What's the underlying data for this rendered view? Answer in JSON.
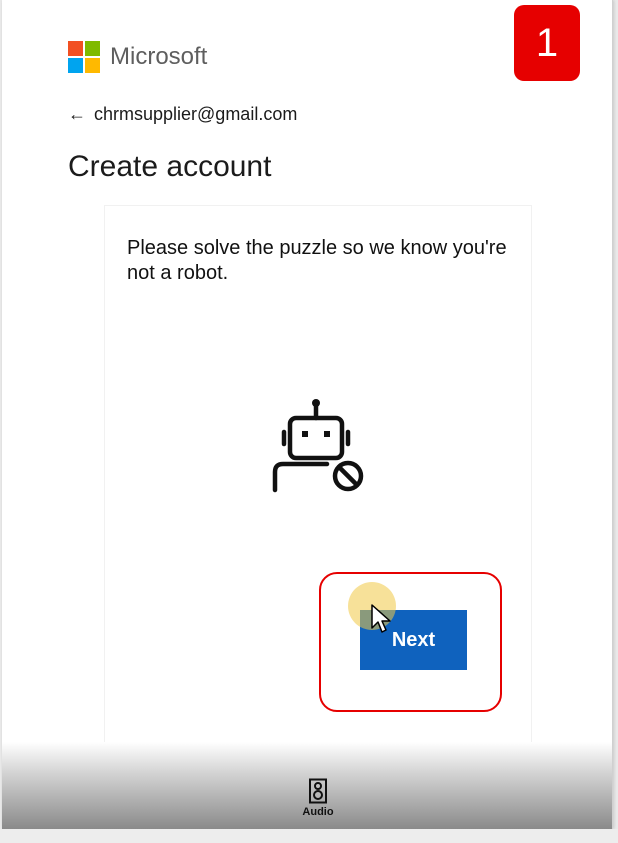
{
  "brand": {
    "name": "Microsoft",
    "colors": [
      "#f25022",
      "#7fba00",
      "#00a4ef",
      "#ffb900"
    ]
  },
  "step_badge": {
    "label": "1",
    "color": "#e60000"
  },
  "identity": {
    "back_icon": "arrow-left-icon",
    "email": "chrmsupplier@gmail.com"
  },
  "page": {
    "title": "Create account"
  },
  "puzzle": {
    "instructions": "Please solve the puzzle so we know you're not a robot.",
    "icon": "robot-blocked-icon",
    "next_label": "Next",
    "next_color": "#0f62be"
  },
  "footer": {
    "audio_label": "Audio",
    "audio_icon": "speaker-icon"
  }
}
